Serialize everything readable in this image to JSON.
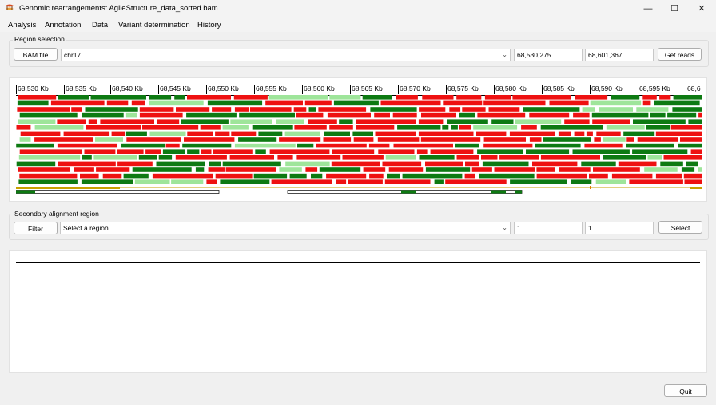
{
  "window": {
    "title": "Genomic rearrangements: AgileStructure_data_sorted.bam",
    "minimize": "—",
    "maximize": "☐",
    "close": "✕"
  },
  "menu": [
    "Analysis",
    "Annotation",
    "Data",
    "Variant determination",
    "History"
  ],
  "region_selection": {
    "label": "Region selection",
    "bam_button": "BAM file",
    "chromosome": "chr17",
    "start": "68,530,275",
    "end": "68,601,367",
    "get_reads_button": "Get reads"
  },
  "ruler": {
    "ticks": [
      "68,530 Kb",
      "68,535 Kb",
      "68,540 Kb",
      "68,545 Kb",
      "68,550 Kb",
      "68,555 Kb",
      "68,560 Kb",
      "68,565 Kb",
      "68,570 Kb",
      "68,575 Kb",
      "68,580 Kb",
      "68,585 Kb",
      "68,590 Kb",
      "68,595 Kb",
      "68,6"
    ]
  },
  "reads_colors": {
    "red": "#ee1111",
    "dark_green": "#0d7a12",
    "light_green": "#9ee59a",
    "gold": "#c8a000",
    "orange": "#e07a00"
  },
  "secondary_region": {
    "label": "Secondary alignment region",
    "filter_button": "Filter",
    "region_select": "Select a region",
    "field1": "1",
    "field2": "1",
    "select_button": "Select"
  },
  "quit_button": "Quit"
}
